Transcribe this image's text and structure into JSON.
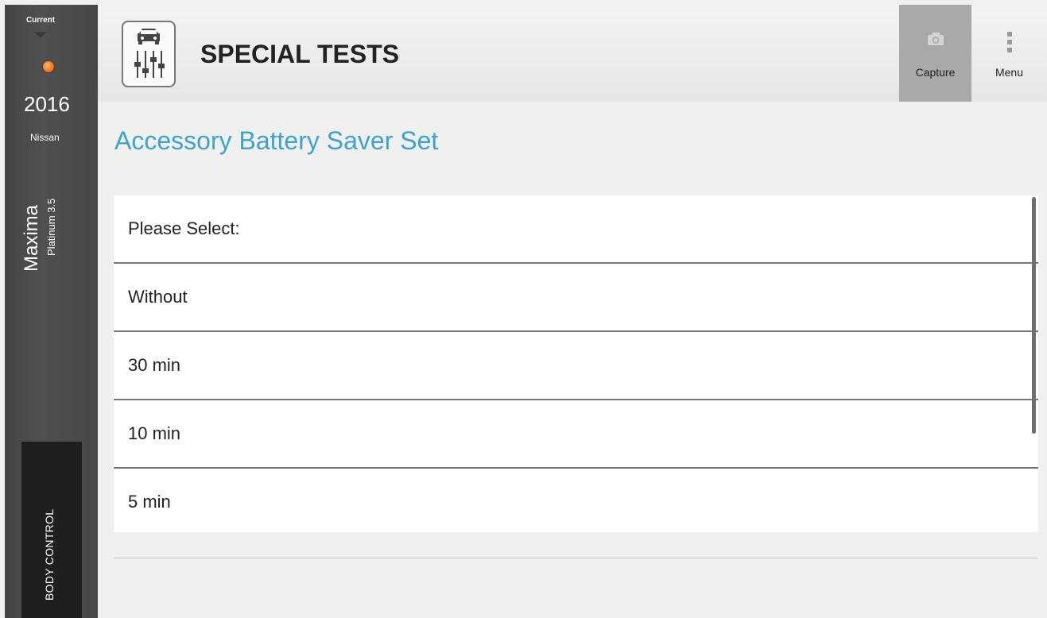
{
  "vehicle": {
    "current_label": "Current",
    "year": "2016",
    "make": "Nissan",
    "model": "Maxima",
    "trim": "Platinum 3.5",
    "module": "BODY CONTROL",
    "status_color": "#f47b20"
  },
  "header": {
    "title": "SPECIAL TESTS",
    "app_icon": "car-sliders-icon",
    "capture_label": "Capture",
    "menu_label": "Menu"
  },
  "main": {
    "section_title": "Accessory Battery Saver Set",
    "accent_color": "#3ea2cf",
    "list": {
      "items": [
        {
          "label": "Please Select:"
        },
        {
          "label": "Without"
        },
        {
          "label": "30 min"
        },
        {
          "label": "10 min"
        },
        {
          "label": "5 min"
        }
      ]
    }
  }
}
